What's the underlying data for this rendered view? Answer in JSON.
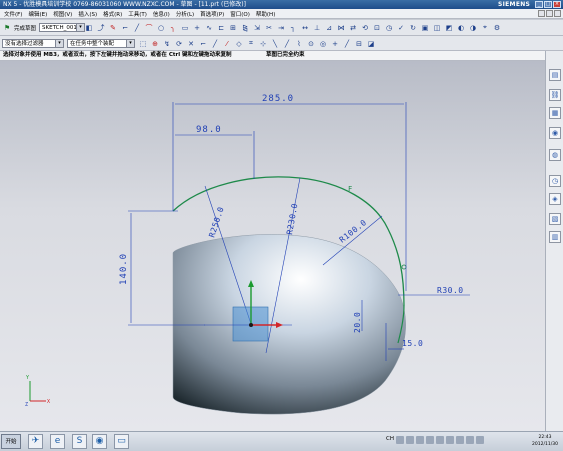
{
  "window": {
    "title": "NX 5 - 优胜模具培训学校 0769-86031060 WWW.NZXC.COM - 草图 - [11.prt (已修改)]",
    "brand": "SIEMENS"
  },
  "menu": {
    "items": [
      "文件(F)",
      "编辑(E)",
      "视图(V)",
      "插入(S)",
      "格式(R)",
      "工具(T)",
      "信息(I)",
      "分析(L)",
      "首选项(P)",
      "窗口(O)",
      "帮助(H)"
    ]
  },
  "toolbar": {
    "finish_sketch_label": "完成草图",
    "sketch_name": "SKETCH_001",
    "selection_filter": "没有选择过滤器",
    "scope": "在任务中整个装配"
  },
  "status": {
    "prompt": "选择对象并使用 MB3，或者双击，按下左键并拖动来移动，或者在 Ctrl 键和左键拖动来复制",
    "sketch_state": "草图已完全约束"
  },
  "dimensions": {
    "d_width": "285.0",
    "d_offset": "98.0",
    "d_height": "140.0",
    "r_250": "R250.0",
    "r_230": "R230.0",
    "r_100": "R100.0",
    "r_30": "R30.0",
    "d_20": "20.0",
    "d_15": "15.0"
  },
  "axis_labels": {
    "x": "X",
    "y": "Y",
    "z": "Z"
  },
  "taskbar": {
    "start_label": "开始",
    "lang": "CH",
    "time": "22:43",
    "date": "2012/11/30"
  },
  "colors": {
    "sketch_curve": "#1e8a4a",
    "dimension": "#1f3fb5",
    "title_bar": "#2a5c96",
    "canvas_bg": "#d4d6dc"
  }
}
